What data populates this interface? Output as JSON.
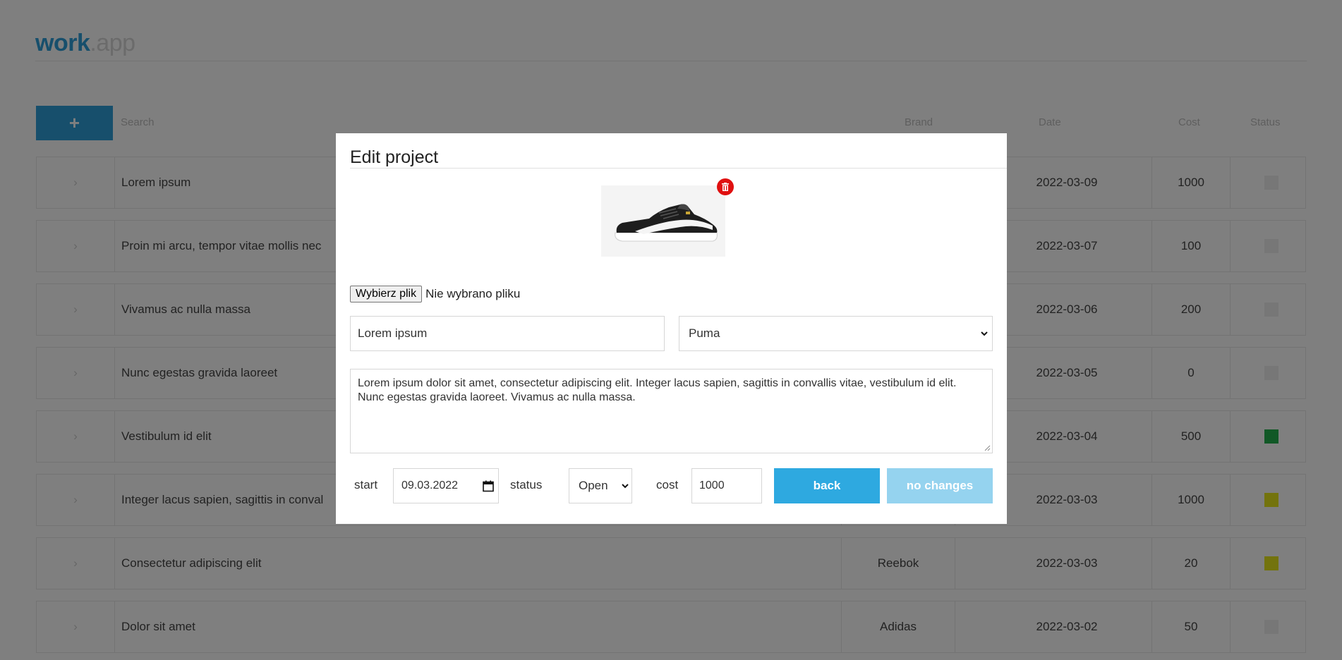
{
  "app": {
    "logo_work": "work",
    "logo_app": ".app",
    "add_button_label": "+",
    "search_label": "Search",
    "columns": [
      "Brand",
      "Date",
      "Cost",
      "Status"
    ],
    "rows": [
      {
        "name": "Lorem ipsum",
        "brand": "",
        "date": "2022-03-09",
        "cost": "1000",
        "status_color": ""
      },
      {
        "name": "Proin mi arcu, tempor vitae mollis nec",
        "brand": "",
        "date": "2022-03-07",
        "cost": "100",
        "status_color": ""
      },
      {
        "name": "Vivamus ac nulla massa",
        "brand": "",
        "date": "2022-03-06",
        "cost": "200",
        "status_color": ""
      },
      {
        "name": "Nunc egestas gravida laoreet",
        "brand": "",
        "date": "2022-03-05",
        "cost": "0",
        "status_color": ""
      },
      {
        "name": "Vestibulum id elit",
        "brand": "",
        "date": "2022-03-04",
        "cost": "500",
        "status_color": "#22b04c"
      },
      {
        "name": "Integer lacus sapien, sagittis in conval",
        "brand": "",
        "date": "2022-03-03",
        "cost": "1000",
        "status_color": "#e6e61a"
      },
      {
        "name": "Consectetur adipiscing elit",
        "brand": "Reebok",
        "date": "2022-03-03",
        "cost": "20",
        "status_color": "#e6e61a"
      },
      {
        "name": "Dolor sit amet",
        "brand": "Adidas",
        "date": "2022-03-02",
        "cost": "50",
        "status_color": ""
      }
    ]
  },
  "modal": {
    "title": "Edit project",
    "image_alt": "sneaker-image",
    "file_button_label": "Wybierz plik",
    "file_status": "Nie wybrano pliku",
    "name_value": "Lorem ipsum",
    "brand_value": "Puma",
    "description": "Lorem ipsum dolor sit amet, consectetur adipiscing elit. Integer lacus sapien, sagittis in convallis vitae, vestibulum id elit. Nunc egestas gravida laoreet. Vivamus ac nulla massa.",
    "start_label": "start",
    "start_value": "09.03.2022",
    "status_label": "status",
    "status_value": "Open",
    "cost_label": "cost",
    "cost_value": "1000",
    "back_label": "back",
    "nochange_label": "no changes"
  },
  "colors": {
    "accent": "#2ea9e0",
    "accent_disabled": "#95d3ef",
    "delete": "#e01010"
  }
}
